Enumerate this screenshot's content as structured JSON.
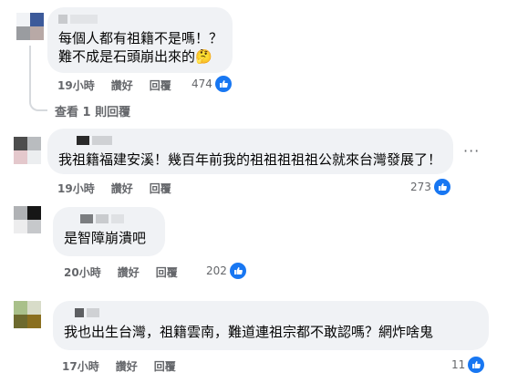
{
  "comments": [
    {
      "text_lines": [
        "每個人都有祖籍不是嗎！？",
        "難不成是石頭崩出來的🤔"
      ],
      "time": "19小時",
      "like": "讚好",
      "reply": "回覆",
      "reactions": "474"
    },
    {
      "text_lines": [
        "我祖籍福建安溪！幾百年前我的祖祖祖祖祖公就來台灣發展了！"
      ],
      "time": "19小時",
      "like": "讚好",
      "reply": "回覆",
      "reactions": "273"
    },
    {
      "text_lines": [
        "是智障崩潰吧"
      ],
      "time": "20小時",
      "like": "讚好",
      "reply": "回覆",
      "reactions": "202"
    },
    {
      "text_lines": [
        "我也出生台灣，祖籍雲南，難道連祖宗都不敢認嗎？網炸啥鬼"
      ],
      "time": "17小時",
      "like": "讚好",
      "reply": "回覆",
      "reactions": "11"
    }
  ],
  "view_replies": "查看 1 則回覆",
  "more_icon": "more-options-icon",
  "like_reaction_icon": "thumbs-up-icon",
  "colors": {
    "bubble": "#f0f2f5",
    "meta_text": "#65676b",
    "like_blue": "#1877f2"
  }
}
